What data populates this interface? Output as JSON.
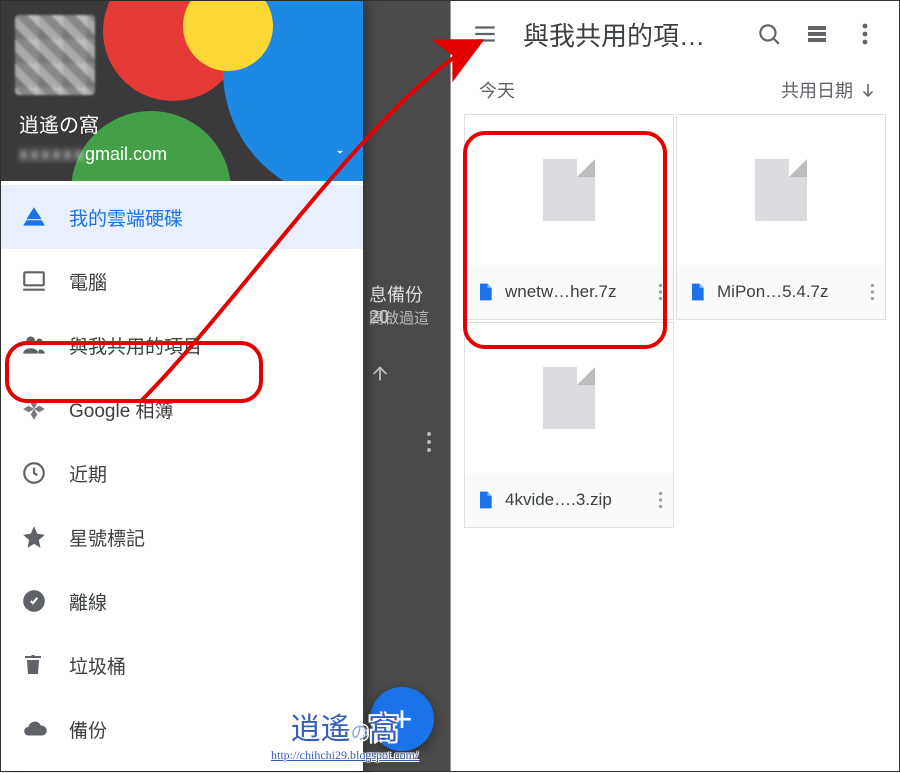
{
  "account": {
    "display_name": "逍遙の窩",
    "email_visible_part": "gmail.com"
  },
  "nav": [
    {
      "key": "my-drive",
      "label": "我的雲端硬碟",
      "active": true
    },
    {
      "key": "computers",
      "label": "電腦"
    },
    {
      "key": "shared",
      "label": "與我共用的項目"
    },
    {
      "key": "photos",
      "label": "Google 相簿"
    },
    {
      "key": "recent",
      "label": "近期"
    },
    {
      "key": "starred",
      "label": "星號標記"
    },
    {
      "key": "offline",
      "label": "離線"
    },
    {
      "key": "trash",
      "label": "垃圾桶"
    },
    {
      "key": "backups",
      "label": "備份"
    }
  ],
  "peek": {
    "folder_title_fragment": "息備份 20",
    "folder_subtitle_fragment": "開啟過這"
  },
  "right": {
    "title": "與我共用的項…",
    "section_label": "今天",
    "sort_label": "共用日期",
    "files": [
      {
        "name": "wnetw…her.7z"
      },
      {
        "name": "MiPon…5.4.7z"
      },
      {
        "name": "4kvide….3.zip"
      }
    ]
  },
  "watermark": {
    "line1_main": "逍遙",
    "line1_small": "の",
    "line1_tail": "窩",
    "line2": "http://chihchi29.blogspot.com/"
  }
}
